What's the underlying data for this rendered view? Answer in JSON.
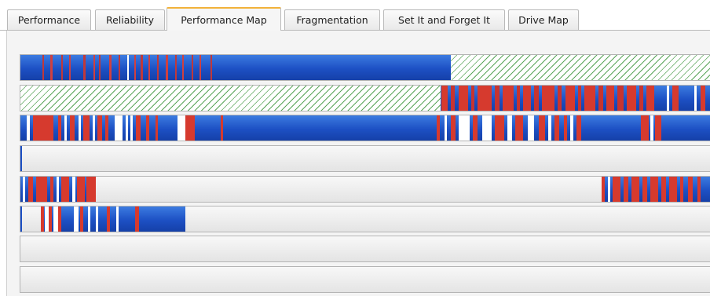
{
  "tabs": [
    {
      "label": "Performance",
      "active": false
    },
    {
      "label": "Reliability",
      "active": false
    },
    {
      "label": "Performance Map",
      "active": true
    },
    {
      "label": "Fragmentation",
      "active": false
    },
    {
      "label": "Set It and Forget It",
      "active": false
    },
    {
      "label": "Drive Map",
      "active": false
    }
  ],
  "map": {
    "row_count": 8,
    "colors": {
      "used": "#1d50c4",
      "hot": "#d63a2e",
      "free_hatch": "#5aa65a",
      "empty": "#e8e8e8",
      "active_tab_accent": "#f2b23a"
    }
  }
}
